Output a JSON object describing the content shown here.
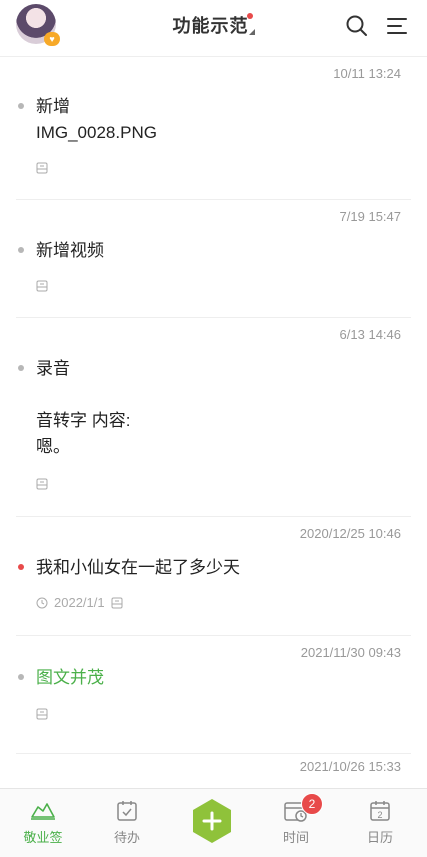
{
  "header": {
    "title": "功能示范",
    "avatar_badge": "♥"
  },
  "entries": [
    {
      "time": "10/11 13:24",
      "text": "新增\nIMG_0028.PNG",
      "meta": ""
    },
    {
      "time": "7/19 15:47",
      "text": "新增视频",
      "meta": ""
    },
    {
      "time": "6/13 14:46",
      "text": "录音\n\n音转字 内容:\n嗯。",
      "meta": ""
    },
    {
      "time": "2020/12/25 10:46",
      "text": "我和小仙女在一起了多少天",
      "meta": "2022/1/1"
    },
    {
      "time": "2021/11/30 09:43",
      "text": "图文并茂",
      "meta": ""
    },
    {
      "time": "2021/10/26 15:33",
      "text": "",
      "meta": ""
    }
  ],
  "tabs": {
    "t1": "敬业签",
    "t2": "待办",
    "t4": "时间",
    "t5": "日历",
    "time_badge": "2",
    "calendar_day": "2"
  },
  "colors": {
    "accent": "#4bb04a",
    "red": "#e84a4a",
    "muted": "#999999"
  }
}
